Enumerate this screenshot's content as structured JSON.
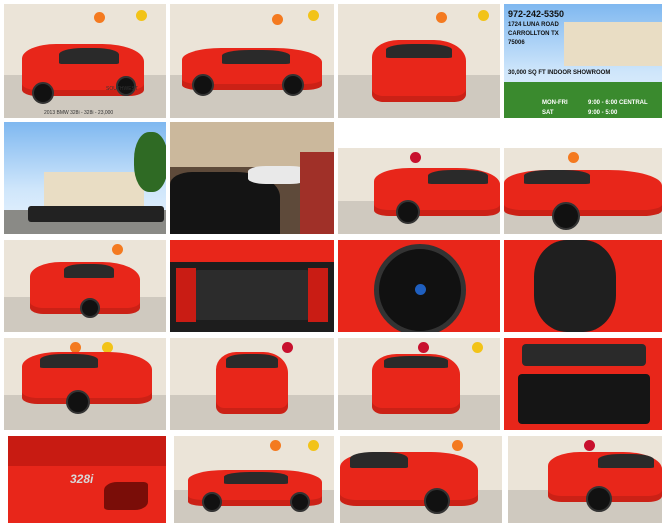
{
  "showroom": {
    "phone": "972-242-5350",
    "street": "1724 LUNA ROAD",
    "city": "CARROLLTON TX",
    "zip": "75006",
    "sqft": "30,000 SQ FT INDOOR SHOWROOM",
    "hours_weekday_label": "MON-FRI",
    "hours_weekday": "9:00 - 6:00 CENTRAL",
    "hours_sat_label": "SAT",
    "hours_sat": "9:00 - 5:00"
  },
  "caption_first": "2013 BMW 328i - 328i - 23,000",
  "watermark": "SOUTHWEST",
  "wall_logos": [
    "Gulf",
    "OK",
    "76",
    "Mobil",
    "Shell"
  ],
  "badge_text": "328i",
  "colors": {
    "car_red": "#e8261a",
    "wall": "#ebe4d8",
    "floor": "#cfc9bf",
    "gulf_orange": "#f47a20",
    "mobil_red": "#c8102e"
  }
}
